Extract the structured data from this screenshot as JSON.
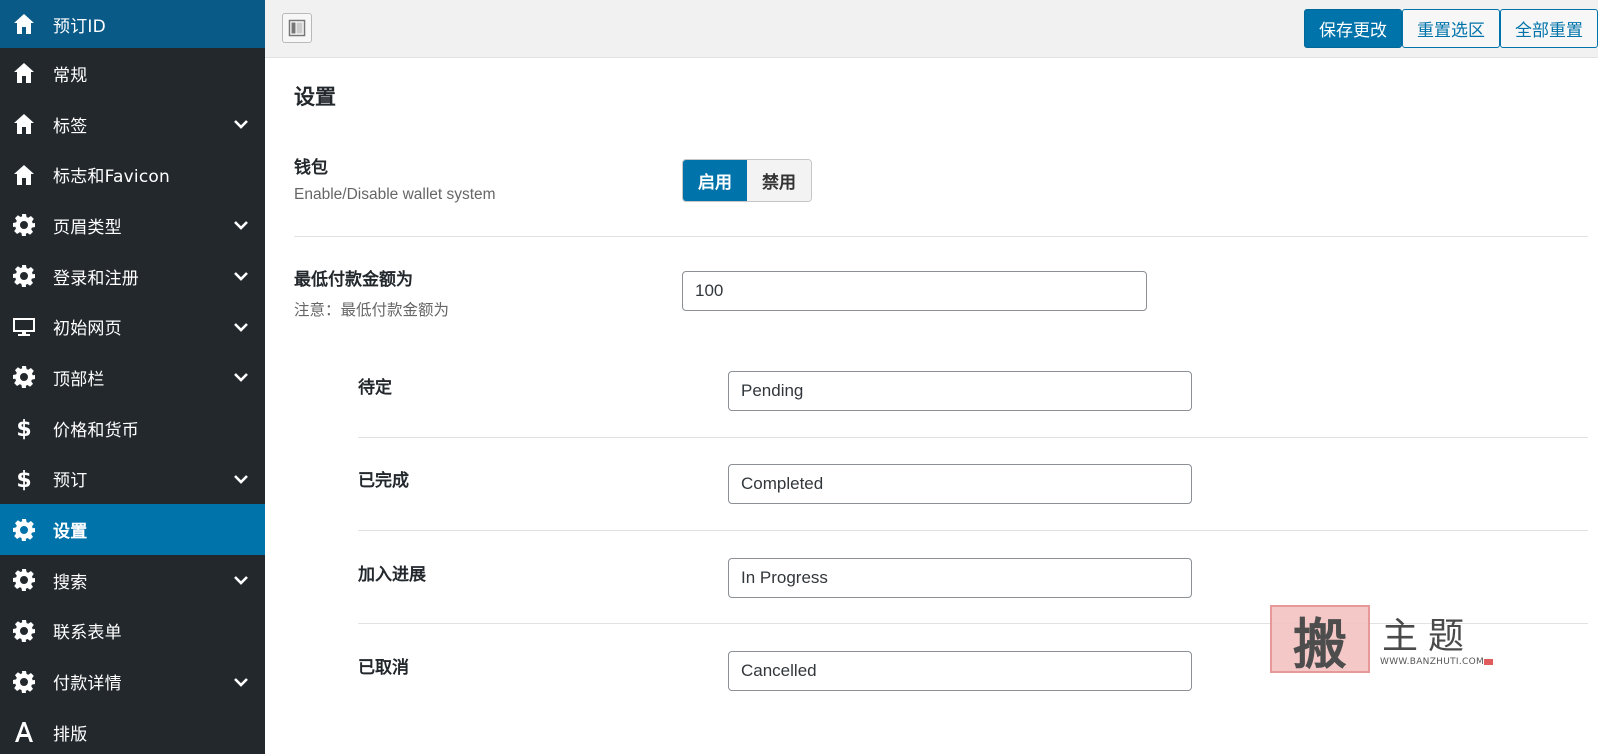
{
  "sidebar": {
    "items": [
      {
        "label": "预订ID",
        "icon": "home-icon",
        "has_children": false
      },
      {
        "label": "常规",
        "icon": "home-icon",
        "has_children": false
      },
      {
        "label": "标签",
        "icon": "home-icon",
        "has_children": true
      },
      {
        "label": "标志和Favicon",
        "icon": "home-icon",
        "has_children": false
      },
      {
        "label": "页眉类型",
        "icon": "gear-icon",
        "has_children": true
      },
      {
        "label": "登录和注册",
        "icon": "gear-icon",
        "has_children": true
      },
      {
        "label": "初始网页",
        "icon": "monitor-icon",
        "has_children": true
      },
      {
        "label": "顶部栏",
        "icon": "gear-icon",
        "has_children": true
      },
      {
        "label": "价格和货币",
        "icon": "dollar-icon",
        "has_children": false
      },
      {
        "label": "预订",
        "icon": "dollar-icon",
        "has_children": true
      },
      {
        "label": "设置",
        "icon": "gear-icon",
        "has_children": false,
        "active": true
      },
      {
        "label": "搜索",
        "icon": "gear-icon",
        "has_children": true
      },
      {
        "label": "联系表单",
        "icon": "gear-icon",
        "has_children": false
      },
      {
        "label": "付款详情",
        "icon": "gear-icon",
        "has_children": true
      },
      {
        "label": "排版",
        "icon": "typography-icon",
        "has_children": false
      }
    ]
  },
  "toolbar": {
    "save_label": "保存更改",
    "reset_section_label": "重置选区",
    "reset_all_label": "全部重置"
  },
  "main": {
    "title": "设置",
    "wallet": {
      "title": "钱包",
      "desc": "Enable/Disable wallet system",
      "on_label": "启用",
      "off_label": "禁用",
      "selected": "启用"
    },
    "min_payment": {
      "title": "最低付款金额为",
      "desc": "注意：最低付款金额为",
      "value": "100"
    },
    "statuses": [
      {
        "label": "待定",
        "value": "Pending"
      },
      {
        "label": "已完成",
        "value": "Completed"
      },
      {
        "label": "加入进展",
        "value": "In Progress"
      },
      {
        "label": "已取消",
        "value": "Cancelled"
      }
    ]
  },
  "watermark": {
    "stamp_char": "搬",
    "text": "主题",
    "url": "WWW.BANZHUTI.COM"
  },
  "colors": {
    "sidebar_bg": "#23282d",
    "accent": "#0073aa",
    "first_item_bg": "#0a5a88"
  }
}
